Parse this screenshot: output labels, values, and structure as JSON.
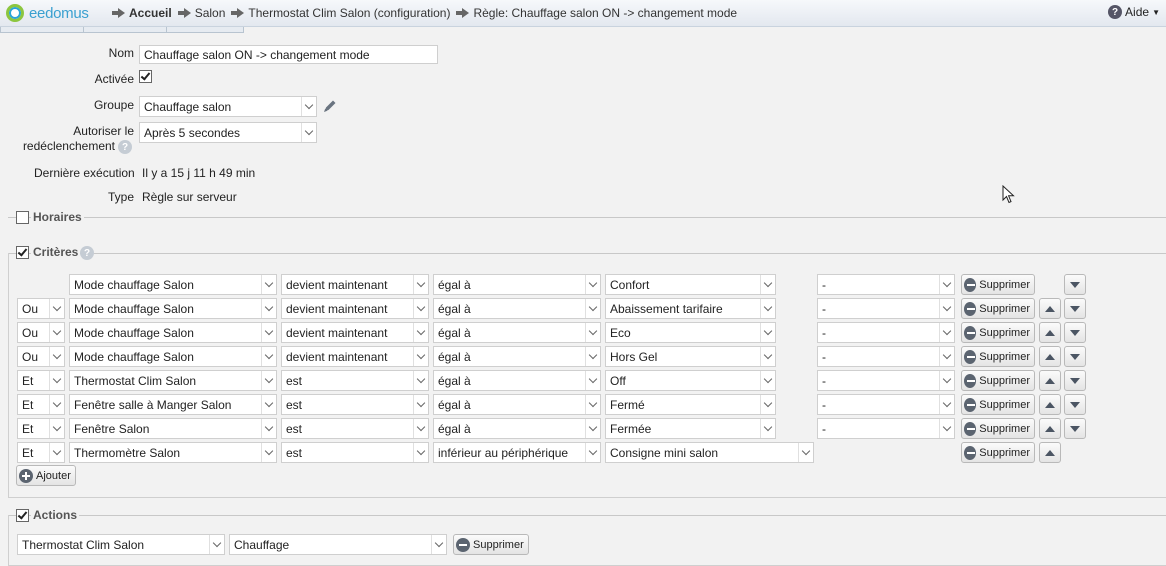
{
  "app": {
    "logo_text": "eedomus",
    "help_label": "Aide"
  },
  "breadcrumb": [
    "Accueil",
    "Salon",
    "Thermostat Clim Salon (configuration)",
    "Règle: Chauffage salon ON -> changement mode"
  ],
  "form": {
    "nom_label": "Nom",
    "nom_value": "Chauffage salon ON -> changement mode",
    "activee_label": "Activée",
    "groupe_label": "Groupe",
    "groupe_value": "Chauffage salon",
    "autoriser_label_1": "Autoriser le",
    "autoriser_label_2": "redéclenchement",
    "autoriser_value": "Après 5 secondes",
    "derniere_label": "Dernière exécution",
    "derniere_value": "Il y a 15 j 11 h 49 min",
    "type_label": "Type",
    "type_value": "Règle sur serveur"
  },
  "sections": {
    "horaires": "Horaires",
    "criteres": "Critères",
    "actions": "Actions"
  },
  "criteria": [
    {
      "op": "",
      "device": "Mode chauffage Salon",
      "cond": "devient maintenant",
      "cmp": "égal à",
      "value": "Confort",
      "extra": "-"
    },
    {
      "op": "Ou",
      "device": "Mode chauffage Salon",
      "cond": "devient maintenant",
      "cmp": "égal à",
      "value": "Abaissement tarifaire",
      "extra": "-"
    },
    {
      "op": "Ou",
      "device": "Mode chauffage Salon",
      "cond": "devient maintenant",
      "cmp": "égal à",
      "value": "Eco",
      "extra": "-"
    },
    {
      "op": "Ou",
      "device": "Mode chauffage Salon",
      "cond": "devient maintenant",
      "cmp": "égal à",
      "value": "Hors Gel",
      "extra": "-"
    },
    {
      "op": "Et",
      "device": "Thermostat Clim Salon",
      "cond": "est",
      "cmp": "égal à",
      "value": "Off",
      "extra": "-"
    },
    {
      "op": "Et",
      "device": "Fenêtre salle à Manger Salon",
      "cond": "est",
      "cmp": "égal à",
      "value": "Fermé",
      "extra": "-"
    },
    {
      "op": "Et",
      "device": "Fenêtre Salon",
      "cond": "est",
      "cmp": "égal à",
      "value": "Fermée",
      "extra": "-"
    },
    {
      "op": "Et",
      "device": "Thermomètre Salon",
      "cond": "est",
      "cmp": "inférieur au périphérique",
      "value": "Consigne mini salon",
      "extra": ""
    }
  ],
  "buttons": {
    "supprimer": "Supprimer",
    "ajouter": "Ajouter"
  },
  "action": {
    "device": "Thermostat Clim Salon",
    "value": "Chauffage"
  }
}
